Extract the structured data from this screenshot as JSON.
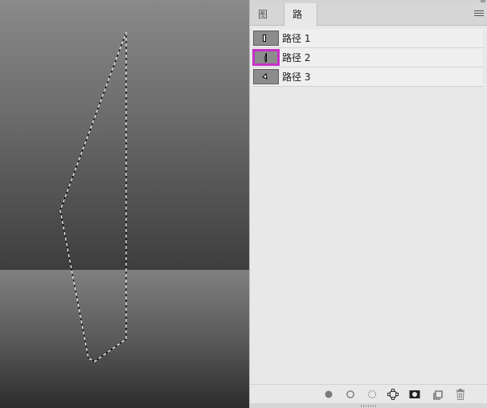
{
  "panel": {
    "tabs": [
      {
        "label": "图层",
        "active": false
      },
      {
        "label": "路径",
        "active": true
      }
    ],
    "paths": [
      {
        "name": "路径 1",
        "selected": false
      },
      {
        "name": "路径 2",
        "selected": true
      },
      {
        "name": "路径 3",
        "selected": false
      }
    ],
    "footer_icons": [
      "fill-path-icon",
      "stroke-path-icon",
      "load-selection-icon",
      "make-work-path-icon",
      "add-mask-icon",
      "new-path-icon",
      "delete-path-icon"
    ]
  },
  "colors": {
    "selection_highlight": "#c830c8",
    "panel_background": "#e8e8e8"
  }
}
